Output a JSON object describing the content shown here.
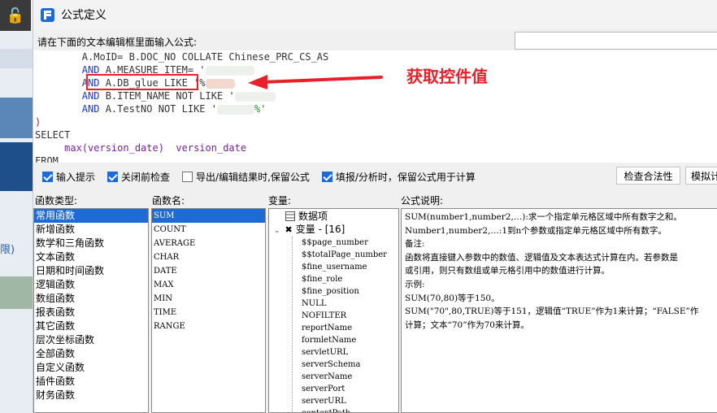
{
  "window": {
    "title": "公式定义"
  },
  "prompt": {
    "label": "请在下面的文本编辑框里面输入公式:"
  },
  "search": {
    "placeholder": ""
  },
  "editor": {
    "lines": [
      {
        "indent": "        ",
        "kw": "",
        "rest": "A.MoID= B.DOC_NO COLLATE Chinese_PRC_CS_AS"
      },
      {
        "indent": "        ",
        "kw": "AND",
        "rest": " A.MEASURE_ITEM= '"
      },
      {
        "indent": "        ",
        "kw": "AND",
        "rest": " A.DB_glue LIKE '%"
      },
      {
        "indent": "        ",
        "kw": "AND",
        "rest": " B.ITEM_NAME NOT LIKE '"
      },
      {
        "indent": "        ",
        "kw": "AND",
        "rest": " A.TestNO NOT LIKE '"
      },
      {
        "indent": "",
        "kw": "",
        "rest": ")"
      },
      {
        "indent": "",
        "kw": "",
        "rest": "SELECT"
      },
      {
        "indent": "     ",
        "kw": "",
        "rest": "max(version_date)  version_date"
      },
      {
        "indent": "",
        "kw": "",
        "rest": "FROM"
      }
    ],
    "tail_str": "%'"
  },
  "annotation": {
    "label": "获取控件值",
    "color": "#e8202a"
  },
  "options": {
    "input_hint": {
      "label": "输入提示",
      "checked": true
    },
    "check_before_close": {
      "label": "关闭前检查",
      "checked": true
    },
    "keep_on_export": {
      "label": "导出/编辑结果时,保留公式",
      "checked": false
    },
    "keep_on_fill": {
      "label": "填报/分析时，保留公式用于计算",
      "checked": true
    },
    "validate_button": "检查合法性",
    "simulate_button": "模拟计"
  },
  "headers": {
    "function_type": "函数类型:",
    "function_name": "函数名:",
    "variables": "变量:",
    "formula_desc": "公式说明:"
  },
  "function_types": [
    "常用函数",
    "新增函数",
    "数学和三角函数",
    "文本函数",
    "日期和时间函数",
    "逻辑函数",
    "数组函数",
    "报表函数",
    "其它函数",
    "层次坐标函数",
    "全部函数",
    "自定义函数",
    "插件函数",
    "财务函数"
  ],
  "function_names": [
    "SUM",
    "COUNT",
    "AVERAGE",
    "CHAR",
    "DATE",
    "MAX",
    "MIN",
    "TIME",
    "RANGE"
  ],
  "variables": {
    "data_item": "数据项",
    "var_group": "变量 - [16]",
    "items": [
      "$$page_number",
      "$$totalPage_number",
      "$fine_username",
      "$fine_role",
      "$fine_position",
      "NULL",
      "NOFILTER",
      "reportName",
      "formletName",
      "servletURL",
      "serverSchema",
      "serverName",
      "serverPort",
      "serverURL",
      "contextPath"
    ]
  },
  "description": [
    "SUM(number1,number2,…):求一个指定单元格区域中所有数字之和。",
    "Number1,number2,…:1到n个参数或指定单元格区域中所有数字。",
    "备注:",
    "函数将直接键入参数中的数值、逻辑值及文本表达式计算在内。若参数是",
    "或引用，则只有数组或单元格引用中的数值进行计算。",
    "示例:",
    "SUM(70,80)等于150。",
    "SUM(\"70\",80,TRUE)等于151，逻辑值“TRUE”作为1来计算；“FALSE”作",
    "计算；文本“70”作为70来计算。"
  ],
  "background": {
    "fragment": "限)"
  }
}
